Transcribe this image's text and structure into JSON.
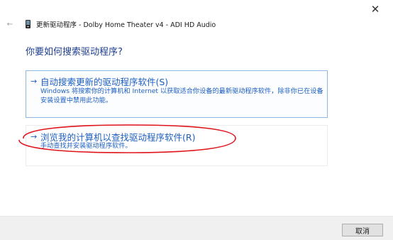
{
  "window": {
    "close_glyph": "✕",
    "back_glyph": "←",
    "title": "更新驱动程序 - Dolby Home Theater v4 - ADI HD Audio"
  },
  "heading": "你要如何搜索驱动程序?",
  "options": [
    {
      "arrow": "→",
      "title": "自动搜索更新的驱动程序软件(S)",
      "description": "Windows 将搜索你的计算机和 Internet 以获取适合你设备的最新驱动程序软件，除非你已在设备安装设置中禁用此功能。"
    },
    {
      "arrow": "→",
      "title": "浏览我的计算机以查找驱动程序软件(R)",
      "description": "手动查找并安装驱动程序软件。"
    }
  ],
  "footer": {
    "cancel_label": "取消"
  },
  "colors": {
    "link_blue": "#1e5fc0",
    "heading_blue": "#1e3e8f",
    "highlight_red": "#e0141b",
    "option_border": "#8eb7e2",
    "footer_bg": "#f0f0f0"
  },
  "icons": [
    "close-icon",
    "back-arrow-icon",
    "device-icon",
    "arrow-right-icon"
  ]
}
